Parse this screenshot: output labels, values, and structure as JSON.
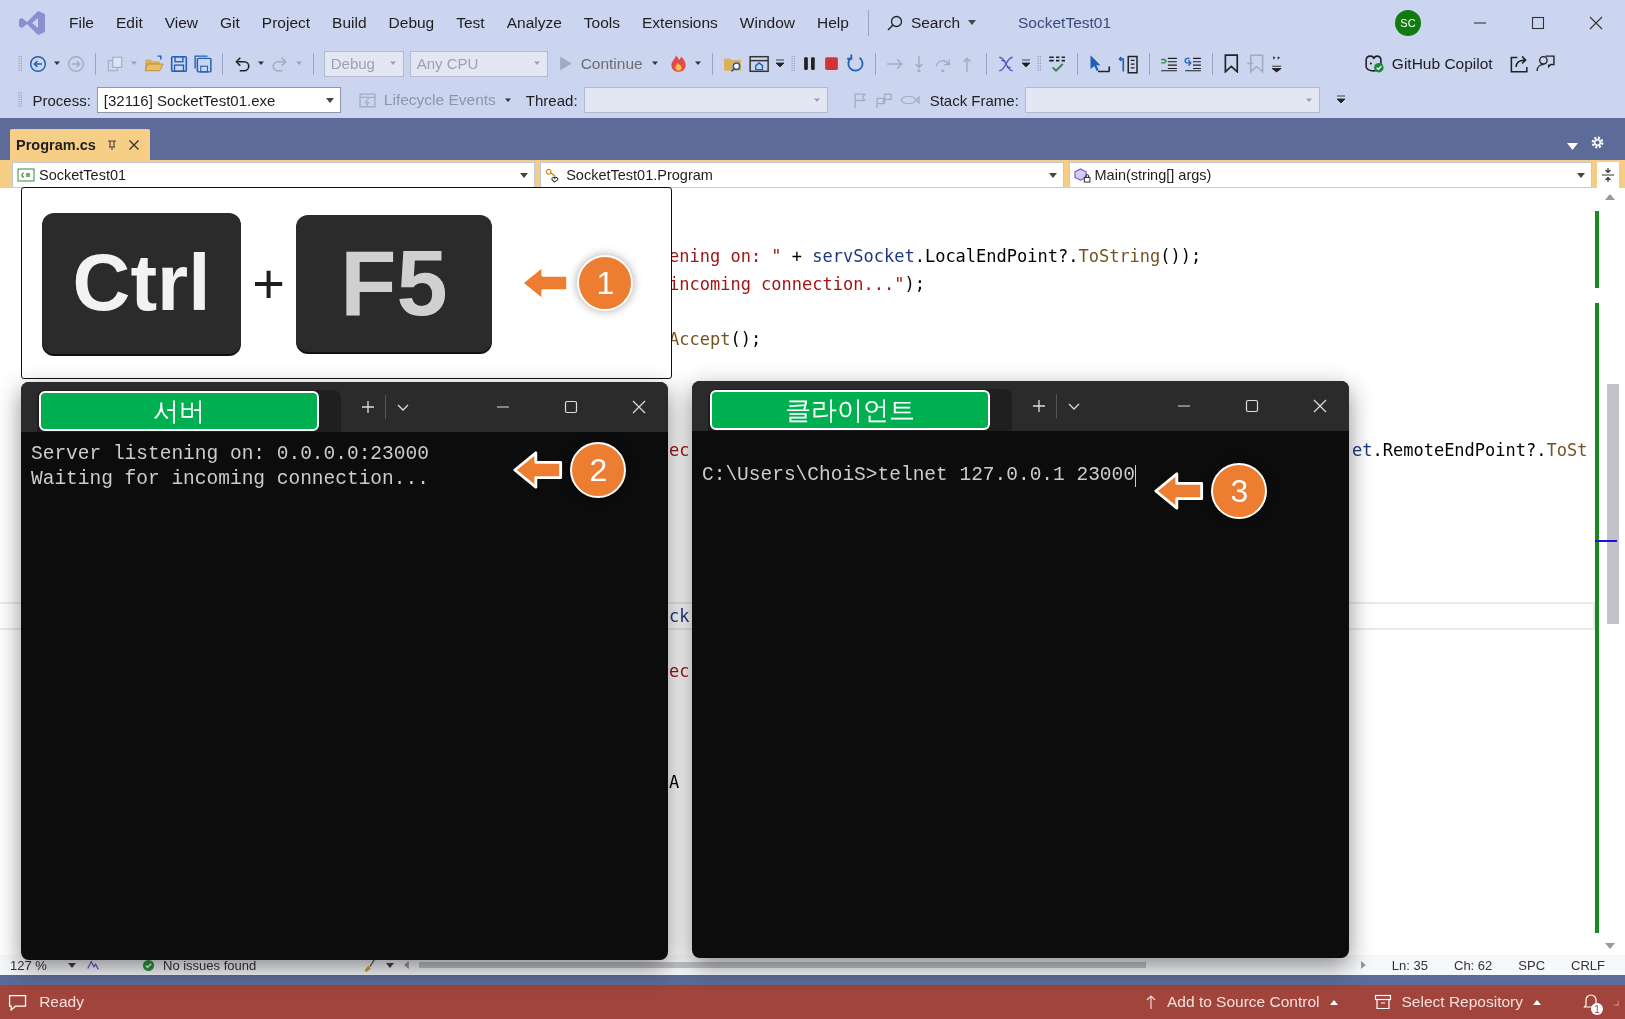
{
  "window": {
    "title": "SocketTest01",
    "avatar": "SC"
  },
  "menu": [
    "File",
    "Edit",
    "View",
    "Git",
    "Project",
    "Build",
    "Debug",
    "Test",
    "Analyze",
    "Tools",
    "Extensions",
    "Window",
    "Help"
  ],
  "search": {
    "label": "Search"
  },
  "toolbar": {
    "configuration": {
      "value": "Debug",
      "disabled": true
    },
    "platform": {
      "value": "Any CPU",
      "disabled": true
    },
    "continue": "Continue",
    "copilot": "GitHub Copilot"
  },
  "debug_location": {
    "process_label": "Process:",
    "process": "[32116] SocketTest01.exe",
    "lifecycle": {
      "label": "Lifecycle Events",
      "disabled": true
    },
    "thread_label": "Thread:",
    "stack_frame_label": "Stack Frame:"
  },
  "tabs": [
    {
      "label": "Program.cs",
      "selected": true
    }
  ],
  "navigation": {
    "project": "SocketTest01",
    "type": "SocketTest01.Program",
    "member": "Main(string[] args)"
  },
  "code_lines": [
    {
      "current": false,
      "segments": [
        {
          "text": "ening on: \" ",
          "kind": "string"
        },
        {
          "text": "+ ",
          "kind": "plain"
        },
        {
          "text": "servSocket",
          "kind": "variable"
        },
        {
          "text": ".LocalEndPoint?.",
          "kind": "plain"
        },
        {
          "text": "ToString",
          "kind": "method"
        },
        {
          "text": "());",
          "kind": "plain"
        }
      ]
    },
    {
      "current": false,
      "segments": [
        {
          "text": "incoming connection...\"",
          "kind": "string"
        },
        {
          "text": ");",
          "kind": "plain"
        }
      ]
    },
    {
      "current": false
    },
    {
      "current": false,
      "segments": [
        {
          "text": "Accept",
          "kind": "method"
        },
        {
          "text": "();",
          "kind": "plain"
        }
      ]
    },
    {
      "current": false
    },
    {
      "current": false
    },
    {
      "current": false
    },
    {
      "current": false,
      "segments": [
        {
          "text": "ec",
          "kind": "string"
        }
      ],
      "right_part": [
        {
          "text": "et",
          "kind": "variable"
        },
        {
          "text": ".RemoteEndPoint?.",
          "kind": "plain"
        },
        {
          "text": "ToSt",
          "kind": "method"
        }
      ]
    },
    {
      "current": false
    },
    {
      "current": false
    },
    {
      "current": false
    },
    {
      "current": false
    },
    {
      "current": false
    },
    {
      "current": true,
      "segments": [
        {
          "text": "ck",
          "kind": "variable"
        }
      ]
    },
    {
      "current": false
    },
    {
      "current": false,
      "segments": [
        {
          "text": "ec",
          "kind": "string"
        }
      ]
    },
    {
      "current": false
    },
    {
      "current": false
    },
    {
      "current": false
    },
    {
      "current": false,
      "segments": [
        {
          "text": "A",
          "kind": "plain"
        }
      ]
    }
  ],
  "shortcut": {
    "keys": [
      "Ctrl",
      "F5"
    ],
    "joiner": "+",
    "step": "1"
  },
  "terminals": [
    {
      "tab": "서버",
      "lines": [
        "Server listening on: 0.0.0.0:23000",
        "Waiting for incoming connection..."
      ],
      "step": "2",
      "cursor": false
    },
    {
      "tab": "클라이언트",
      "lines": [
        "C:\\Users\\ChoiS>telnet 127.0.0.1 23000"
      ],
      "step": "3",
      "cursor": true
    }
  ],
  "editor_status": {
    "zoom": "127 %",
    "issues": "No issues found",
    "line": "Ln: 35",
    "column": "Ch: 62",
    "whitespace": "SPC",
    "line_ending": "CRLF"
  },
  "status_bar": {
    "state": "Ready",
    "source_control": "Add to Source Control",
    "repository": "Select Repository",
    "notifications": "1"
  }
}
